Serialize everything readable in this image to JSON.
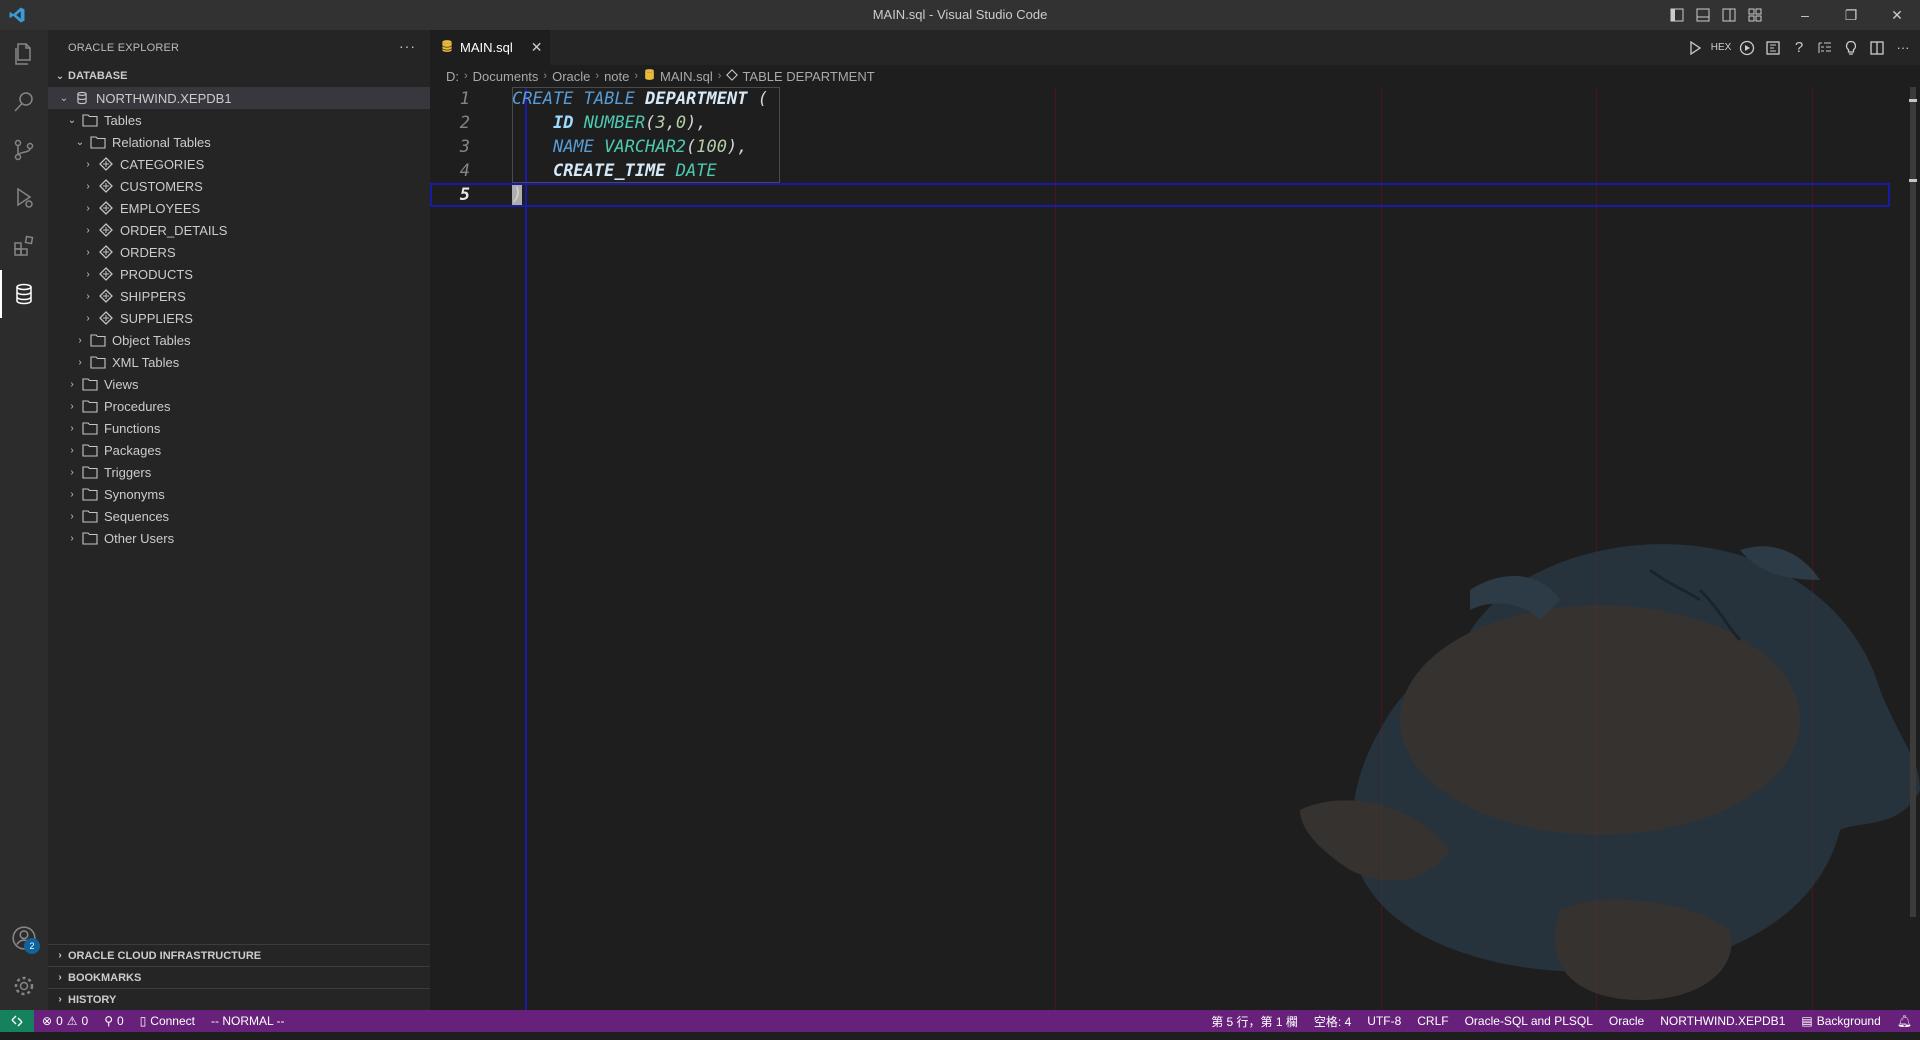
{
  "window": {
    "title": "MAIN.sql - Visual Studio Code",
    "minimize": "–",
    "restore": "❐",
    "close": "✕"
  },
  "sidebar": {
    "title": "ORACLE EXPLORER",
    "more": "···",
    "section": "DATABASE",
    "connection": "NORTHWIND.XEPDB1",
    "tables_folder": "Tables",
    "relational_tables": "Relational Tables",
    "tables": [
      "CATEGORIES",
      "CUSTOMERS",
      "EMPLOYEES",
      "ORDER_DETAILS",
      "ORDERS",
      "PRODUCTS",
      "SHIPPERS",
      "SUPPLIERS"
    ],
    "table_subfolders": [
      "Object Tables",
      "XML Tables"
    ],
    "folders": [
      "Views",
      "Procedures",
      "Functions",
      "Packages",
      "Triggers",
      "Synonyms",
      "Sequences",
      "Other Users"
    ],
    "bottom_sections": [
      "ORACLE CLOUD INFRASTRUCTURE",
      "BOOKMARKS",
      "HISTORY"
    ]
  },
  "activity": {
    "accounts_badge": "2"
  },
  "editor": {
    "tab_label": "MAIN.sql",
    "tab_close": "✕",
    "hex_label": "HEX",
    "more": "···",
    "breadcrumbs": [
      "D:",
      "Documents",
      "Oracle",
      "note",
      "MAIN.sql",
      "TABLE DEPARTMENT"
    ],
    "line_numbers": [
      "1",
      "2",
      "3",
      "4",
      "5"
    ],
    "code": {
      "l1": [
        "CREATE",
        "TABLE",
        "DEPARTMENT",
        "("
      ],
      "l2": [
        "ID",
        "NUMBER",
        "(",
        "3",
        ",",
        "0",
        "),"
      ],
      "l3": [
        "NAME",
        "VARCHAR2",
        "(",
        "100",
        "),"
      ],
      "l4": [
        "CREATE_TIME",
        "DATE"
      ],
      "l5": [
        ")"
      ]
    }
  },
  "statusbar": {
    "errors": "0",
    "warnings": "0",
    "ports": "0",
    "connect": "Connect",
    "mode": "-- NORMAL --",
    "position": "第 5 行，第 1 欄",
    "spaces": "空格: 4",
    "encoding": "UTF-8",
    "eol": "CRLF",
    "language": "Oracle-SQL and PLSQL",
    "db": "Oracle",
    "connection": "NORTHWIND.XEPDB1",
    "background": "Background"
  },
  "colors": {
    "statusbar": "#68217a",
    "remote": "#16825d",
    "keyword": "#569cd6",
    "type": "#4ec9b0",
    "number": "#b5cea8"
  }
}
